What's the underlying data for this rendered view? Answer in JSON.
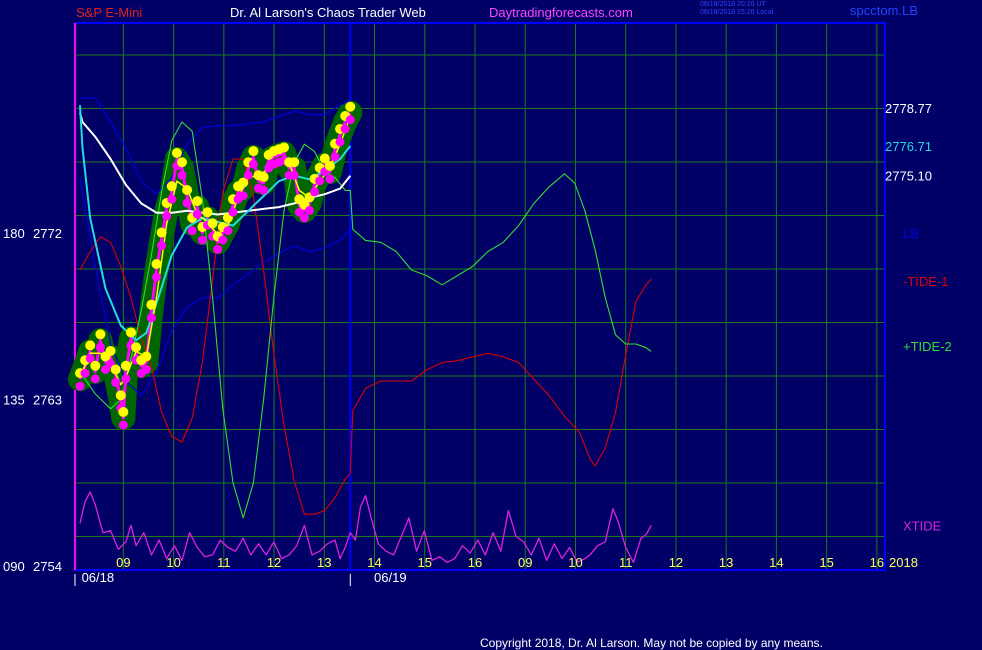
{
  "header": {
    "symbol": "S&P E-Mini",
    "site": "Dr. Al Larson's Chaos Trader Web",
    "url": "Daytradingforecasts.com",
    "timestamp_line1": "06/18/2018 20:20 UT",
    "timestamp_line2": "06/18/2018 15:20 Local",
    "product_code": "spcctom.LB"
  },
  "footer": {
    "copyright": "Copyright 2018, Dr. Al Larson. May not be copied by any means."
  },
  "colors": {
    "background": "#000066",
    "grid": "#1a7a1a",
    "frame": "#0000ff",
    "price_band": "#006600",
    "price": "#ff00ff",
    "close_dot": "#ffff00",
    "fast_avg": "#ffff00",
    "mid_avg": "#22dddd",
    "slow_avg": "#ffffff",
    "envelope": "#0000dd",
    "tide_minus_1": "#dd0000",
    "tide_plus_2": "#33dd33",
    "xtide": "#dd22dd"
  },
  "chart_data": {
    "type": "line",
    "x_hour_ticks": [
      "09",
      "10",
      "11",
      "12",
      "13",
      "14",
      "15",
      "16",
      "09",
      "10",
      "11",
      "12",
      "13",
      "14",
      "15",
      "16"
    ],
    "date_labels": [
      "06/18",
      "06/19"
    ],
    "y_axis_labels": [
      {
        "index": "180",
        "price": "2772",
        "value": 2772
      },
      {
        "index": "135",
        "price": "2763",
        "value": 2763
      },
      {
        "index": "090",
        "price": "2754",
        "value": 2754
      }
    ],
    "ylim": [
      2754,
      2779.3
    ],
    "year_label": "2018",
    "right_labels": [
      {
        "text": "2778.77",
        "value": 2778.77,
        "color": "#ffffff"
      },
      {
        "text": "2776.71",
        "value": 2776.71,
        "color": "#22dddd"
      },
      {
        "text": "2775.10",
        "value": 2775.1,
        "color": "#ffffff"
      }
    ],
    "series_labels": [
      {
        "text": "LB",
        "color": "#0000dd",
        "value": 2772
      },
      {
        "text": "-TIDE-1",
        "color": "#dd0000",
        "value": 2769.4
      },
      {
        "text": "+TIDE-2",
        "color": "#33dd33",
        "value": 2765.9
      },
      {
        "text": "XTIDE",
        "color": "#dd22dd",
        "value": 2756.2
      }
    ],
    "price": [
      [
        0.0,
        2764.1
      ],
      [
        0.1,
        2764.8
      ],
      [
        0.2,
        2765.6
      ],
      [
        0.3,
        2764.5
      ],
      [
        0.4,
        2766.2
      ],
      [
        0.5,
        2765.0
      ],
      [
        0.6,
        2765.3
      ],
      [
        0.7,
        2764.3
      ],
      [
        0.8,
        2762.9
      ],
      [
        0.85,
        2762.0
      ],
      [
        0.9,
        2764.5
      ],
      [
        1.0,
        2766.3
      ],
      [
        1.1,
        2765.5
      ],
      [
        1.2,
        2764.8
      ],
      [
        1.3,
        2765.0
      ],
      [
        1.4,
        2767.8
      ],
      [
        1.5,
        2770.0
      ],
      [
        1.6,
        2771.7
      ],
      [
        1.7,
        2773.3
      ],
      [
        1.8,
        2774.2
      ],
      [
        1.9,
        2776.0
      ],
      [
        2.0,
        2775.5
      ],
      [
        2.1,
        2774.0
      ],
      [
        2.2,
        2772.5
      ],
      [
        2.3,
        2773.4
      ],
      [
        2.4,
        2772.0
      ],
      [
        2.5,
        2772.8
      ],
      [
        2.6,
        2772.2
      ],
      [
        2.7,
        2771.5
      ],
      [
        2.8,
        2772.0
      ],
      [
        2.9,
        2772.5
      ],
      [
        3.0,
        2773.5
      ],
      [
        3.1,
        2774.2
      ],
      [
        3.2,
        2774.4
      ],
      [
        3.3,
        2775.5
      ],
      [
        3.4,
        2776.1
      ],
      [
        3.5,
        2774.8
      ],
      [
        3.6,
        2774.7
      ],
      [
        3.7,
        2775.9
      ],
      [
        3.8,
        2776.1
      ],
      [
        3.9,
        2776.2
      ],
      [
        4.0,
        2776.3
      ],
      [
        4.1,
        2775.5
      ],
      [
        4.2,
        2775.5
      ],
      [
        4.3,
        2773.5
      ],
      [
        4.4,
        2773.2
      ],
      [
        4.5,
        2773.6
      ],
      [
        4.6,
        2774.6
      ],
      [
        4.7,
        2775.2
      ],
      [
        4.8,
        2775.7
      ],
      [
        4.9,
        2775.3
      ],
      [
        5.0,
        2776.5
      ],
      [
        5.1,
        2777.3
      ],
      [
        5.2,
        2778.0
      ],
      [
        5.3,
        2778.5
      ]
    ],
    "fast_avg": [
      [
        0.0,
        2764.2
      ],
      [
        0.2,
        2765.5
      ],
      [
        0.4,
        2765.5
      ],
      [
        0.6,
        2765.0
      ],
      [
        0.8,
        2763.8
      ],
      [
        0.9,
        2764.2
      ],
      [
        1.1,
        2765.6
      ],
      [
        1.3,
        2765.3
      ],
      [
        1.5,
        2768.5
      ],
      [
        1.7,
        2772.5
      ],
      [
        1.9,
        2774.8
      ],
      [
        2.1,
        2774.4
      ],
      [
        2.3,
        2773.0
      ],
      [
        2.5,
        2772.6
      ],
      [
        2.7,
        2771.9
      ],
      [
        2.9,
        2772.4
      ],
      [
        3.1,
        2773.9
      ],
      [
        3.3,
        2775.0
      ],
      [
        3.5,
        2775.1
      ],
      [
        3.7,
        2775.5
      ],
      [
        3.9,
        2776.0
      ],
      [
        4.1,
        2775.8
      ],
      [
        4.3,
        2774.3
      ],
      [
        4.5,
        2773.9
      ],
      [
        4.7,
        2774.8
      ],
      [
        4.9,
        2775.5
      ],
      [
        5.1,
        2776.8
      ],
      [
        5.3,
        2778.3
      ]
    ],
    "mid_avg": [
      [
        0.0,
        2778.9
      ],
      [
        0.05,
        2776.6
      ],
      [
        0.2,
        2772.8
      ],
      [
        0.5,
        2769.0
      ],
      [
        0.8,
        2767.0
      ],
      [
        1.1,
        2766.2
      ],
      [
        1.3,
        2766.6
      ],
      [
        1.5,
        2768.2
      ],
      [
        1.8,
        2770.8
      ],
      [
        2.1,
        2772.3
      ],
      [
        2.4,
        2772.8
      ],
      [
        2.7,
        2772.6
      ],
      [
        3.0,
        2772.4
      ],
      [
        3.3,
        2773.2
      ],
      [
        3.6,
        2774.0
      ],
      [
        3.9,
        2774.8
      ],
      [
        4.2,
        2775.1
      ],
      [
        4.5,
        2774.9
      ],
      [
        4.8,
        2775.4
      ],
      [
        5.1,
        2776.0
      ],
      [
        5.3,
        2776.71
      ]
    ],
    "slow_avg": [
      [
        0.0,
        2778.5
      ],
      [
        0.05,
        2778.0
      ],
      [
        0.3,
        2777.2
      ],
      [
        0.6,
        2776.0
      ],
      [
        0.9,
        2774.6
      ],
      [
        1.2,
        2773.6
      ],
      [
        1.5,
        2773.1
      ],
      [
        1.8,
        2773.1
      ],
      [
        2.1,
        2773.2
      ],
      [
        2.4,
        2773.1
      ],
      [
        2.7,
        2773.0
      ],
      [
        3.0,
        2773.1
      ],
      [
        3.3,
        2773.2
      ],
      [
        3.6,
        2773.3
      ],
      [
        3.9,
        2773.4
      ],
      [
        4.2,
        2773.6
      ],
      [
        4.5,
        2773.9
      ],
      [
        4.8,
        2774.1
      ],
      [
        5.1,
        2774.4
      ],
      [
        5.3,
        2775.1
      ]
    ],
    "envelope_upper": [
      [
        0.0,
        2779.3
      ],
      [
        0.3,
        2779.3
      ],
      [
        0.6,
        2778.0
      ],
      [
        0.9,
        2776.6
      ],
      [
        1.2,
        2774.8
      ],
      [
        1.5,
        2774.1
      ],
      [
        1.8,
        2775.0
      ],
      [
        2.1,
        2776.8
      ],
      [
        2.4,
        2777.7
      ],
      [
        2.7,
        2777.8
      ],
      [
        3.0,
        2777.8
      ],
      [
        3.3,
        2777.9
      ],
      [
        3.6,
        2778.0
      ],
      [
        3.9,
        2778.3
      ],
      [
        4.2,
        2778.6
      ],
      [
        4.5,
        2778.4
      ],
      [
        4.8,
        2778.4
      ],
      [
        5.1,
        2778.9
      ],
      [
        5.3,
        2779.2
      ]
    ],
    "envelope_lower": [
      [
        0.0,
        2775.0
      ],
      [
        0.3,
        2770.2
      ],
      [
        0.6,
        2766.0
      ],
      [
        0.9,
        2764.0
      ],
      [
        1.2,
        2763.2
      ],
      [
        1.5,
        2764.5
      ],
      [
        1.8,
        2766.7
      ],
      [
        2.1,
        2768.0
      ],
      [
        2.4,
        2768.5
      ],
      [
        2.7,
        2768.5
      ],
      [
        3.0,
        2769.2
      ],
      [
        3.3,
        2769.8
      ],
      [
        3.6,
        2770.4
      ],
      [
        3.9,
        2770.9
      ],
      [
        4.2,
        2771.3
      ],
      [
        4.5,
        2771.0
      ],
      [
        4.8,
        2771.2
      ],
      [
        5.1,
        2771.6
      ],
      [
        5.3,
        2772.2
      ]
    ],
    "tide_minus_1": [
      [
        0.0,
        2770.0
      ],
      [
        0.2,
        2771.0
      ],
      [
        0.4,
        2771.8
      ],
      [
        0.6,
        2771.5
      ],
      [
        0.8,
        2770.2
      ],
      [
        1.0,
        2768.5
      ],
      [
        1.2,
        2766.3
      ],
      [
        1.4,
        2764.8
      ],
      [
        1.6,
        2762.3
      ],
      [
        1.8,
        2761.0
      ],
      [
        2.0,
        2760.7
      ],
      [
        2.2,
        2762.0
      ],
      [
        2.4,
        2765.0
      ],
      [
        2.6,
        2769.5
      ],
      [
        2.8,
        2774.2
      ],
      [
        3.0,
        2776.0
      ],
      [
        3.2,
        2776.0
      ],
      [
        3.4,
        2774.0
      ],
      [
        3.6,
        2770.0
      ],
      [
        3.8,
        2765.5
      ],
      [
        4.0,
        2761.6
      ],
      [
        4.2,
        2758.6
      ],
      [
        4.4,
        2756.8
      ],
      [
        4.6,
        2756.8
      ],
      [
        4.8,
        2757.0
      ],
      [
        5.0,
        2757.7
      ],
      [
        5.2,
        2758.7
      ],
      [
        5.3,
        2759.0
      ],
      [
        5.35,
        2762.4
      ],
      [
        5.6,
        2763.6
      ],
      [
        5.9,
        2764.0
      ],
      [
        6.2,
        2764.0
      ],
      [
        6.5,
        2764.0
      ],
      [
        6.8,
        2764.6
      ],
      [
        7.1,
        2765.0
      ],
      [
        7.4,
        2765.1
      ],
      [
        7.7,
        2765.3
      ],
      [
        8.0,
        2765.5
      ],
      [
        8.3,
        2765.3
      ],
      [
        8.6,
        2765.0
      ],
      [
        8.9,
        2764.1
      ],
      [
        9.2,
        2763.2
      ],
      [
        9.5,
        2762.1
      ],
      [
        9.8,
        2761.2
      ],
      [
        10.0,
        2759.8
      ],
      [
        10.1,
        2759.4
      ],
      [
        10.3,
        2760.4
      ],
      [
        10.5,
        2762.3
      ],
      [
        10.7,
        2765.4
      ],
      [
        10.9,
        2768.3
      ],
      [
        11.1,
        2769.2
      ],
      [
        11.2,
        2769.5
      ]
    ],
    "tide_plus_2": [
      [
        0.0,
        2764.5
      ],
      [
        0.3,
        2763.3
      ],
      [
        0.6,
        2762.5
      ],
      [
        0.8,
        2763.0
      ],
      [
        1.0,
        2765.2
      ],
      [
        1.2,
        2767.8
      ],
      [
        1.4,
        2770.8
      ],
      [
        1.6,
        2774.2
      ],
      [
        1.8,
        2777.0
      ],
      [
        2.0,
        2778.0
      ],
      [
        2.2,
        2777.5
      ],
      [
        2.4,
        2773.8
      ],
      [
        2.6,
        2768.5
      ],
      [
        2.8,
        2762.5
      ],
      [
        3.0,
        2758.5
      ],
      [
        3.2,
        2756.6
      ],
      [
        3.4,
        2758.5
      ],
      [
        3.6,
        2763.0
      ],
      [
        3.8,
        2768.5
      ],
      [
        4.0,
        2773.2
      ],
      [
        4.2,
        2775.8
      ],
      [
        4.4,
        2776.8
      ],
      [
        4.6,
        2776.4
      ],
      [
        4.8,
        2775.3
      ],
      [
        5.0,
        2775.0
      ],
      [
        5.2,
        2774.3
      ],
      [
        5.3,
        2774.3
      ],
      [
        5.35,
        2772.2
      ],
      [
        5.6,
        2771.6
      ],
      [
        5.9,
        2771.5
      ],
      [
        6.2,
        2771.0
      ],
      [
        6.5,
        2770.0
      ],
      [
        6.8,
        2769.7
      ],
      [
        7.1,
        2769.2
      ],
      [
        7.4,
        2769.7
      ],
      [
        7.7,
        2770.2
      ],
      [
        8.0,
        2771.0
      ],
      [
        8.3,
        2771.5
      ],
      [
        8.6,
        2772.4
      ],
      [
        8.9,
        2773.6
      ],
      [
        9.2,
        2774.5
      ],
      [
        9.5,
        2775.2
      ],
      [
        9.7,
        2774.7
      ],
      [
        9.9,
        2773.2
      ],
      [
        10.1,
        2771.1
      ],
      [
        10.3,
        2768.5
      ],
      [
        10.5,
        2766.5
      ],
      [
        10.7,
        2766.0
      ],
      [
        10.9,
        2766.0
      ],
      [
        11.1,
        2765.8
      ],
      [
        11.2,
        2765.6
      ]
    ],
    "xtide": [
      [
        0.0,
        2756.3
      ],
      [
        0.1,
        2757.5
      ],
      [
        0.2,
        2758.0
      ],
      [
        0.3,
        2757.3
      ],
      [
        0.45,
        2755.8
      ],
      [
        0.6,
        2755.9
      ],
      [
        0.75,
        2754.9
      ],
      [
        0.9,
        2755.3
      ],
      [
        1.0,
        2756.2
      ],
      [
        1.1,
        2755.1
      ],
      [
        1.25,
        2755.8
      ],
      [
        1.4,
        2754.6
      ],
      [
        1.55,
        2755.4
      ],
      [
        1.7,
        2754.4
      ],
      [
        1.85,
        2755.1
      ],
      [
        2.0,
        2754.3
      ],
      [
        2.15,
        2755.8
      ],
      [
        2.3,
        2755.0
      ],
      [
        2.45,
        2754.5
      ],
      [
        2.6,
        2754.6
      ],
      [
        2.75,
        2755.4
      ],
      [
        2.9,
        2755.0
      ],
      [
        3.05,
        2754.8
      ],
      [
        3.2,
        2755.5
      ],
      [
        3.35,
        2754.6
      ],
      [
        3.5,
        2755.2
      ],
      [
        3.65,
        2754.6
      ],
      [
        3.8,
        2755.3
      ],
      [
        3.95,
        2754.4
      ],
      [
        4.1,
        2754.6
      ],
      [
        4.25,
        2755.1
      ],
      [
        4.4,
        2756.2
      ],
      [
        4.55,
        2754.6
      ],
      [
        4.7,
        2754.8
      ],
      [
        4.85,
        2755.2
      ],
      [
        5.0,
        2755.4
      ],
      [
        5.1,
        2754.4
      ],
      [
        5.2,
        2755.0
      ],
      [
        5.3,
        2755.8
      ],
      [
        5.4,
        2755.4
      ],
      [
        5.5,
        2757.2
      ],
      [
        5.6,
        2757.8
      ],
      [
        5.7,
        2756.7
      ],
      [
        5.85,
        2755.2
      ],
      [
        6.0,
        2754.8
      ],
      [
        6.15,
        2754.6
      ],
      [
        6.3,
        2755.6
      ],
      [
        6.45,
        2756.6
      ],
      [
        6.6,
        2754.8
      ],
      [
        6.75,
        2755.9
      ],
      [
        6.9,
        2754.3
      ],
      [
        7.05,
        2754.5
      ],
      [
        7.2,
        2754.2
      ],
      [
        7.35,
        2754.4
      ],
      [
        7.5,
        2755.1
      ],
      [
        7.65,
        2754.7
      ],
      [
        7.8,
        2755.4
      ],
      [
        7.95,
        2754.6
      ],
      [
        8.1,
        2755.8
      ],
      [
        8.25,
        2754.8
      ],
      [
        8.4,
        2757.0
      ],
      [
        8.55,
        2755.6
      ],
      [
        8.7,
        2755.3
      ],
      [
        8.85,
        2754.6
      ],
      [
        9.0,
        2755.5
      ],
      [
        9.15,
        2754.3
      ],
      [
        9.3,
        2755.2
      ],
      [
        9.45,
        2754.4
      ],
      [
        9.6,
        2755.0
      ],
      [
        9.75,
        2754.2
      ],
      [
        9.9,
        2754.4
      ],
      [
        10.0,
        2754.6
      ],
      [
        10.15,
        2755.1
      ],
      [
        10.3,
        2755.3
      ],
      [
        10.45,
        2757.1
      ],
      [
        10.55,
        2756.4
      ],
      [
        10.7,
        2755.0
      ],
      [
        10.85,
        2754.2
      ],
      [
        11.0,
        2755.5
      ],
      [
        11.1,
        2755.7
      ],
      [
        11.2,
        2756.2
      ]
    ]
  }
}
